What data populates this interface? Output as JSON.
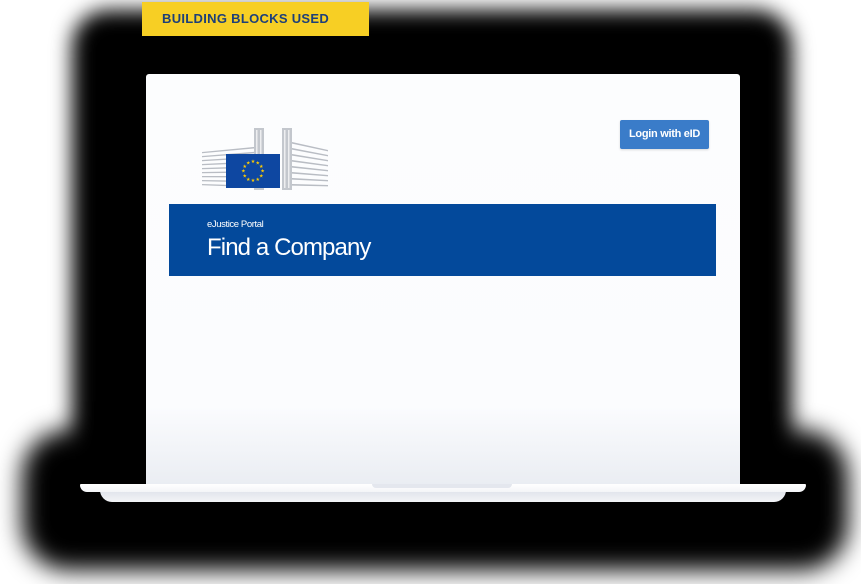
{
  "badge": {
    "label": "BUILDING BLOCKS USED"
  },
  "portal": {
    "login_button": "Login with eID",
    "banner_subtitle": "eJustice Portal",
    "banner_title": "Find a Company"
  },
  "colors": {
    "badge_bg": "#f7cf24",
    "badge_text": "#1d3f79",
    "banner_bg": "#03499b",
    "login_bg": "#3a7cc9",
    "eu_blue": "#0e47a1",
    "eu_star": "#ffcc00"
  },
  "icons": {
    "logo": "european-commission-logo-icon"
  }
}
